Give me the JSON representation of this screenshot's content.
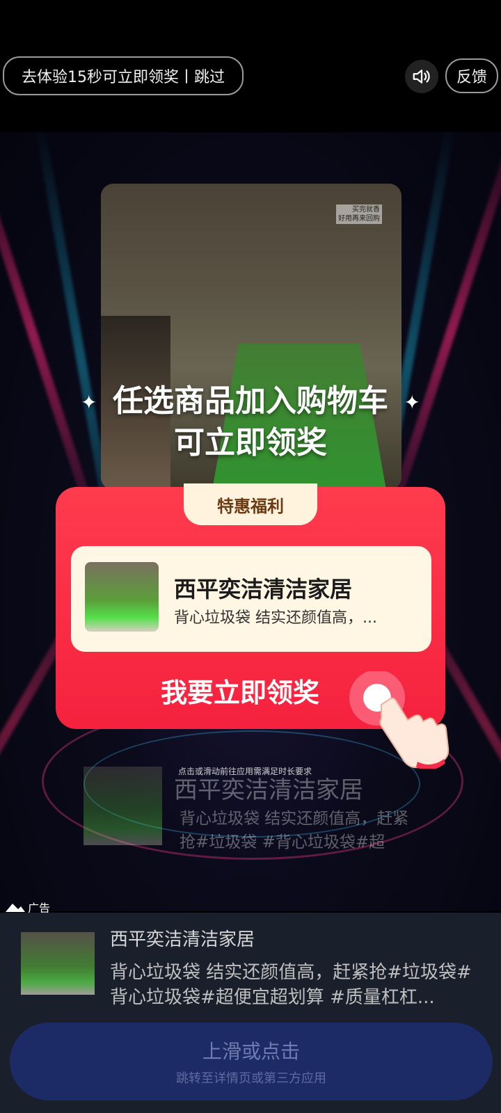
{
  "topbar": {
    "skip_text": "去体验15秒可立即领奖丨跳过",
    "feedback_label": "反馈"
  },
  "video": {
    "overlay_text_line1": "买完就香",
    "overlay_text_line2": "好用再来回购"
  },
  "promo": {
    "headline_line1": "任选商品加入购物车",
    "headline_line2": "可立即领奖",
    "tab_label": "特惠福利",
    "product_title": "西平奕洁清洁家居",
    "product_desc": "背心垃圾袋 结实还颜值高，...",
    "cta_label": "我要立即领奖"
  },
  "secondary": {
    "hint": "点击或滑动前往应用需满足时长要求",
    "title": "西平奕洁清洁家居",
    "desc": "背心垃圾袋 结实还颜值高，赶紧抢#垃圾袋 #背心垃圾袋#超"
  },
  "ad": {
    "label": "广告",
    "title": "西平奕洁清洁家居",
    "desc": "背心垃圾袋 结实还颜值高，赶紧抢#垃圾袋#背心垃圾袋#超便宜超划算 #质量杠杠...",
    "swipe_main": "上滑或点击",
    "swipe_sub": "跳转至详情页或第三方应用"
  },
  "colors": {
    "accent_red": "#f5213e",
    "tab_bg": "#fff3dd",
    "swipe_bg": "#1c2b66"
  },
  "icons": [
    "speaker-icon",
    "hand-pointer-icon",
    "sparkle-icon",
    "ad-triangle-icon"
  ]
}
